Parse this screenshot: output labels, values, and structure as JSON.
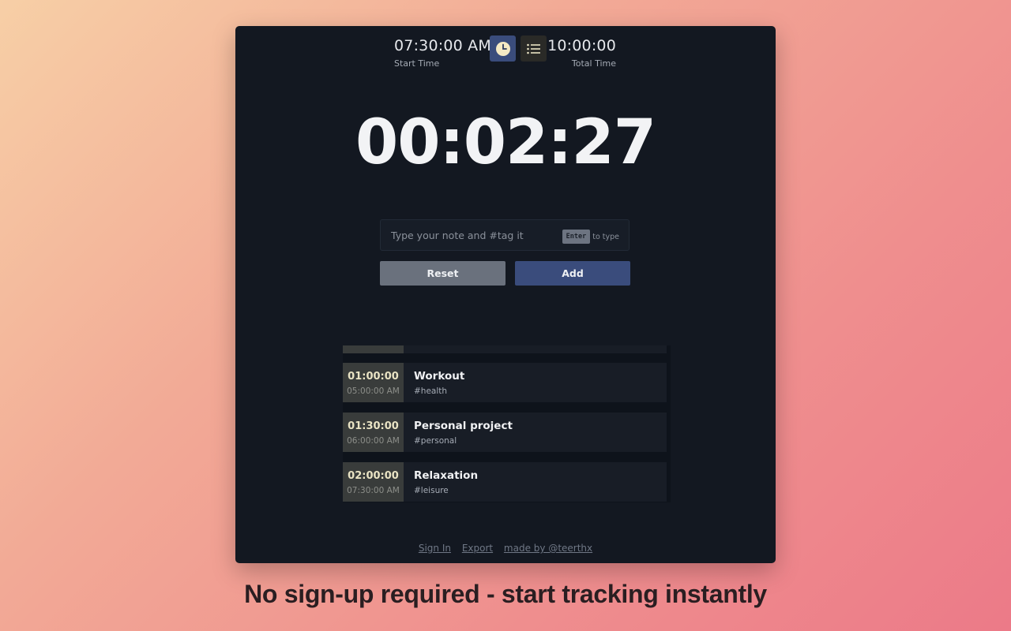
{
  "header": {
    "start_time": "07:30:00 AM",
    "start_label": "Start Time",
    "total_time": "10:00:00",
    "total_label": "Total Time",
    "modes": [
      {
        "icon": "clock-icon",
        "active": true
      },
      {
        "icon": "list-icon",
        "active": false
      }
    ]
  },
  "timer": {
    "elapsed": "00:02:27"
  },
  "note": {
    "placeholder": "Type your note and #tag it",
    "value": "",
    "hint_key": "Enter",
    "hint_text": "to type"
  },
  "actions": {
    "reset_label": "Reset",
    "add_label": "Add"
  },
  "entries": [
    {
      "duration": "01:00:00",
      "time": "05:00:00 AM",
      "title": "Workout",
      "tag": "#health"
    },
    {
      "duration": "01:30:00",
      "time": "06:00:00 AM",
      "title": "Personal project",
      "tag": "#personal"
    },
    {
      "duration": "02:00:00",
      "time": "07:30:00 AM",
      "title": "Relaxation",
      "tag": "#leisure"
    }
  ],
  "footer": {
    "sign_in": "Sign In",
    "export": "Export",
    "credit": "made by @teerthx"
  },
  "caption": "No sign-up required - start tracking instantly",
  "colors": {
    "panel": "#131821",
    "accent": "#3a4c7c",
    "reset": "#6a717d"
  }
}
